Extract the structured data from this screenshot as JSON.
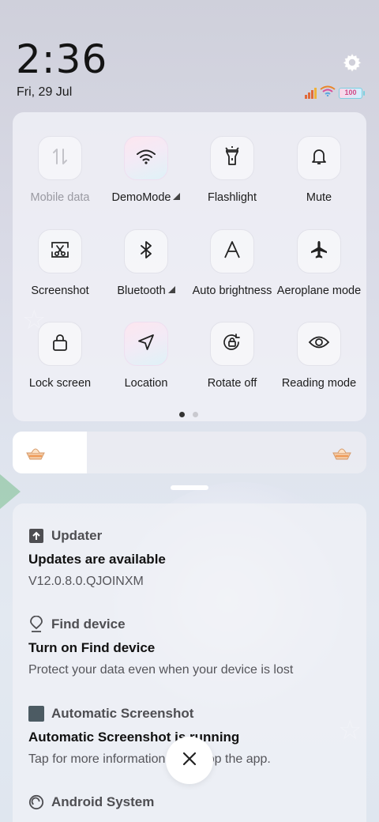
{
  "status": {
    "time": "2:36",
    "date": "Fri, 29 Jul",
    "battery": "100"
  },
  "quick_settings": {
    "tiles": [
      {
        "label": "Mobile data",
        "icon": "mobile-data-icon",
        "active": false,
        "disabled": true,
        "expandable": false
      },
      {
        "label": "DemoMode",
        "icon": "wifi-icon",
        "active": true,
        "disabled": false,
        "expandable": true
      },
      {
        "label": "Flashlight",
        "icon": "flashlight-icon",
        "active": false,
        "disabled": false,
        "expandable": false
      },
      {
        "label": "Mute",
        "icon": "bell-icon",
        "active": false,
        "disabled": false,
        "expandable": false
      },
      {
        "label": "Screenshot",
        "icon": "screenshot-icon",
        "active": false,
        "disabled": false,
        "expandable": false
      },
      {
        "label": "Bluetooth",
        "icon": "bluetooth-icon",
        "active": false,
        "disabled": false,
        "expandable": true
      },
      {
        "label": "Auto brightness",
        "icon": "auto-brightness-icon",
        "active": false,
        "disabled": false,
        "expandable": false
      },
      {
        "label": "Aeroplane mode",
        "icon": "airplane-icon",
        "active": false,
        "disabled": false,
        "expandable": false
      },
      {
        "label": "Lock screen",
        "icon": "lock-icon",
        "active": false,
        "disabled": false,
        "expandable": false
      },
      {
        "label": "Location",
        "icon": "location-icon",
        "active": true,
        "disabled": false,
        "expandable": false
      },
      {
        "label": "Rotate off",
        "icon": "rotate-lock-icon",
        "active": false,
        "disabled": false,
        "expandable": false
      },
      {
        "label": "Reading mode",
        "icon": "eye-icon",
        "active": false,
        "disabled": false,
        "expandable": false
      }
    ],
    "page_count": 2,
    "current_page": 1
  },
  "brightness": {
    "level": 0.21,
    "fill_color": "#ffffff"
  },
  "notifications": [
    {
      "app": "Updater",
      "icon": "upload-arrow-icon",
      "title": "Updates are available",
      "body": "V12.0.8.0.QJOINXM"
    },
    {
      "app": "Find device",
      "icon": "location-pin-icon",
      "title": "Turn on Find device",
      "body": "Protect your data even when your device is lost"
    },
    {
      "app": "Automatic Screenshot",
      "icon": "square-app-icon",
      "title": "Automatic Screenshot is running",
      "body": "Tap for more information or to stop the app."
    },
    {
      "app": "Android System",
      "icon": "android-system-icon",
      "title": "",
      "body": ""
    }
  ],
  "colors": {
    "accent_dark": "#1a1a1a",
    "signal": "#e06a3a",
    "wifi_status": "#e9862c",
    "battery_frame": "#7ad0e0"
  }
}
